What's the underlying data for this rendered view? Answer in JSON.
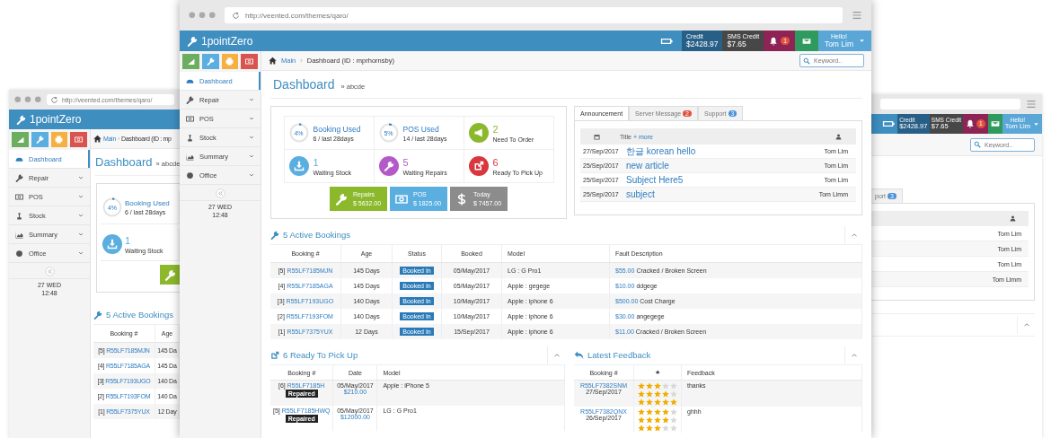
{
  "back_window_left": {
    "url": "http://veented.com/themes/qaro/",
    "brand": "1pointZero",
    "sidebar": {
      "items": [
        {
          "label": "Dashboard",
          "selected": true
        },
        {
          "label": "Repair",
          "selected": false
        },
        {
          "label": "POS",
          "selected": false
        },
        {
          "label": "Stock",
          "selected": false
        },
        {
          "label": "Summary",
          "selected": false
        },
        {
          "label": "Office",
          "selected": false
        }
      ],
      "clock": {
        "day": "27 WED",
        "time": "12:48"
      }
    },
    "breadcrumb": {
      "home": "Main",
      "separator": "›",
      "current": "Dashboard (ID : mp"
    },
    "page": {
      "title": "Dashboard",
      "subtitle": "» abcde"
    },
    "stats": [
      {
        "kind": "ring",
        "level": 0.04,
        "percent": "4%",
        "title": "Booking Used",
        "subtitle": "6 / last 28days"
      },
      {
        "kind": "count",
        "value": "1",
        "label": "Waiting Stock",
        "color": "#5aaee0"
      }
    ],
    "bookings": {
      "title": "5 Active Bookings",
      "columns": [
        "Booking #",
        "Age"
      ],
      "rows": [
        {
          "index": "[5]",
          "booking": "R55LF7185MJN",
          "age": "145 Da"
        },
        {
          "index": "[4]",
          "booking": "R55LF7185AGA",
          "age": "145 Da"
        },
        {
          "index": "[3]",
          "booking": "R55LF7193UGO",
          "age": "140 Da"
        },
        {
          "index": "[2]",
          "booking": "R55LF7193FOM",
          "age": "140 Da"
        },
        {
          "index": "[1]",
          "booking": "R55LF7375YUX",
          "age": "12 Day"
        }
      ]
    }
  },
  "main_window": {
    "url": "http://veented.com/themes/qaro/",
    "brand": "1pointZero",
    "header": {
      "credit": {
        "label": "Credit",
        "value": "$2428.97"
      },
      "sms_credit": {
        "label": "SMS Credit",
        "value": "$7.65"
      },
      "notifications": "1",
      "user": {
        "greeting": "Hello!",
        "name": "Tom Lim"
      }
    },
    "sidebar": {
      "items": [
        {
          "label": "Dashboard",
          "selected": true
        },
        {
          "label": "Repair",
          "selected": false
        },
        {
          "label": "POS",
          "selected": false
        },
        {
          "label": "Stock",
          "selected": false
        },
        {
          "label": "Summary",
          "selected": false
        },
        {
          "label": "Office",
          "selected": false
        }
      ],
      "clock": {
        "day": "27 WED",
        "time": "12:48"
      }
    },
    "breadcrumb": {
      "home": "Main",
      "separator": "›",
      "current": "Dashboard (ID : mprhornsby)"
    },
    "search": {
      "placeholder": "Keyword.."
    },
    "page": {
      "title": "Dashboard",
      "subtitle": "» abcde"
    },
    "stats": [
      {
        "kind": "ring",
        "level": 0.04,
        "percent": "4%",
        "title": "Booking Used",
        "subtitle": "6 / last 28days"
      },
      {
        "kind": "ring",
        "level": 0.05,
        "percent": "5%",
        "title": "POS Used",
        "subtitle": "14 / last 28days"
      },
      {
        "kind": "count",
        "value": "2",
        "label": "Need To Order",
        "color": "#8cb82b"
      },
      {
        "kind": "count",
        "value": "1",
        "label": "Waiting Stock",
        "color": "#5aaee0"
      },
      {
        "kind": "count",
        "value": "5",
        "label": "Waiting Repairs",
        "color": "#b35ac8"
      },
      {
        "kind": "count",
        "value": "6",
        "label": "Ready To Pick Up",
        "color": "#d9363e"
      }
    ],
    "totals": [
      {
        "label": "Repairs",
        "value": "$ 5632.00",
        "color": "#8cb82b"
      },
      {
        "label": "POS",
        "value": "$ 1825.00",
        "color": "#5aaee0"
      },
      {
        "label": "Today",
        "value": "$ 7457.00",
        "color": "#8c8c8c"
      }
    ],
    "announcements": {
      "tabs": [
        {
          "label": "Announcement",
          "selected": true
        },
        {
          "label": "Server Message",
          "badge": "2",
          "color": "#e0533d",
          "selected": false
        },
        {
          "label": "Support",
          "badge": "3",
          "color": "#4a90d9",
          "selected": false
        }
      ],
      "title_header": "Title",
      "more_link": "+ more",
      "rows": [
        {
          "date": "27/Sep/2017",
          "title": "한글 korean hello",
          "user": "Tom Lim"
        },
        {
          "date": "25/Sep/2017",
          "title": "new article",
          "user": "Tom Lim"
        },
        {
          "date": "25/Sep/2017",
          "title": "Subject Here5",
          "user": "Tom Lim"
        },
        {
          "date": "25/Sep/2017",
          "title": "subject",
          "user": "Tom Limm"
        }
      ]
    },
    "active_bookings": {
      "title": "5 Active Bookings",
      "columns": [
        "Booking #",
        "Age",
        "Status",
        "Booked",
        "Model",
        "Fault Description"
      ],
      "rows": [
        {
          "index": "[5]",
          "booking": "R55LF7185MJN",
          "age": "145 Days",
          "status": "Booked In",
          "date": "05/May/2017",
          "model": "LG : G Pro1",
          "price": "$55.00",
          "fault": "Cracked / Broken Screen"
        },
        {
          "index": "[4]",
          "booking": "R55LF7185AGA",
          "age": "145 Days",
          "status": "Booked In",
          "date": "05/May/2017",
          "model": "Apple : gegege",
          "price": "$10.00",
          "fault": "ddgege"
        },
        {
          "index": "[3]",
          "booking": "R55LF7193UGO",
          "age": "140 Days",
          "status": "Booked In",
          "date": "10/May/2017",
          "model": "Apple : iphone 6",
          "price": "$500.00",
          "fault": "Cost Charge"
        },
        {
          "index": "[2]",
          "booking": "R55LF7193FOM",
          "age": "140 Days",
          "status": "Booked In",
          "date": "10/May/2017",
          "model": "Apple : iphone 6",
          "price": "$30.00",
          "fault": "angegege"
        },
        {
          "index": "[1]",
          "booking": "R55LF7375YUX",
          "age": "12 Days",
          "status": "Booked In",
          "date": "15/Sep/2017",
          "model": "Apple : iphone 6",
          "price": "$11.00",
          "fault": "Cracked / Broken Screen"
        }
      ]
    },
    "ready_to_pick_up": {
      "title": "6 Ready To Pick Up",
      "columns": [
        "Booking #",
        "Date",
        "Model"
      ],
      "rows": [
        {
          "index": "[6]",
          "booking": "R55LF7185H",
          "status": "Repaired",
          "date": "05/May/2017",
          "price": "$210.00",
          "model": "Apple : iPhone 5"
        },
        {
          "index": "[5]",
          "booking": "R55LF7185HWQ",
          "status": "Repaired",
          "date": "05/May/2017",
          "price": "$12000.00",
          "model": "LG : G Pro1"
        }
      ]
    },
    "latest_feedback": {
      "title": "Latest Feedback",
      "columns": [
        "Booking #",
        "★",
        "Feedback"
      ],
      "rows": [
        {
          "booking": "R55LF7382SNM",
          "date": "27/Sep/2017",
          "ratings": [
            {
              "stars": 3
            },
            {
              "stars": 4
            },
            {
              "stars": 5
            }
          ],
          "feedback": "thanks"
        },
        {
          "booking": "R55LF7382QNX",
          "date": "26/Sep/2017",
          "ratings": [
            {
              "stars": 4
            },
            {
              "stars": 4
            },
            {
              "stars": 3
            }
          ],
          "feedback": "ghhh"
        }
      ]
    }
  },
  "back_window_right": {
    "header": {
      "credit": {
        "label": "Credit",
        "value": "$2428.97"
      },
      "sms_credit": {
        "label": "SMS Credit",
        "value": "$7.65"
      },
      "notifications": "1",
      "user": {
        "greeting": "Hello!",
        "name": "Tom Lim"
      }
    },
    "search": {
      "placeholder": "Keyword.."
    },
    "tab": {
      "label": "port",
      "badge": "3",
      "color": "#4a90d9"
    },
    "users": [
      "Tom Lim",
      "Tom Lim",
      "Tom Lim",
      "Tom Limm"
    ]
  }
}
